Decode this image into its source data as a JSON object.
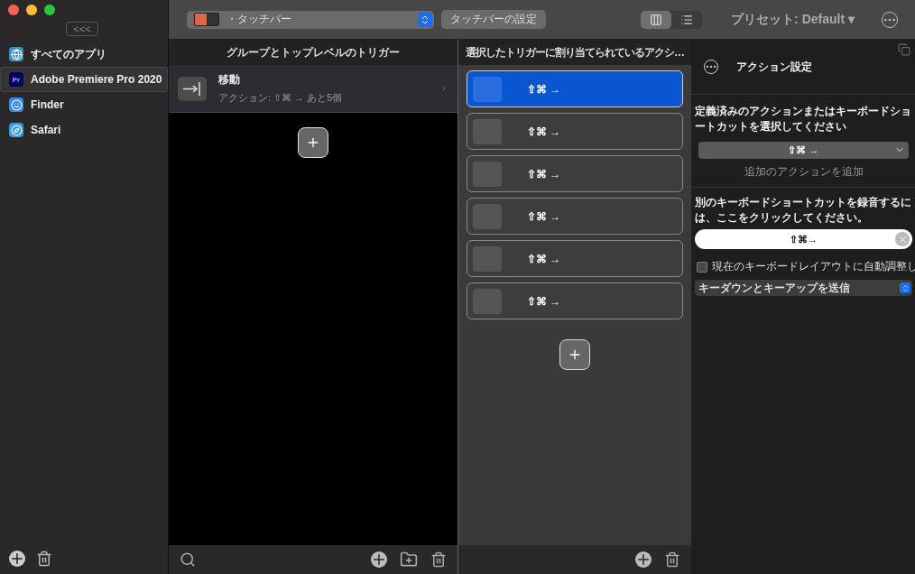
{
  "sidebar": {
    "collapse_button": "<<<",
    "apps": [
      {
        "name": "すべてのアプリ",
        "kind": "all",
        "selected": false
      },
      {
        "name": "Adobe Premiere Pro 2020",
        "kind": "premiere",
        "badge": "Pr",
        "selected": true
      },
      {
        "name": "Finder",
        "kind": "finder",
        "selected": false
      },
      {
        "name": "Safari",
        "kind": "safari",
        "selected": false
      }
    ]
  },
  "toolbar": {
    "touchbar_select": "・タッチバー",
    "settings_button": "タッチバーの設定",
    "view_toggle": [
      {
        "kind": "columns",
        "selected": true
      },
      {
        "kind": "list",
        "selected": false
      }
    ],
    "preset": "プリセット: Default",
    "preset_caret": "▾"
  },
  "triggers": {
    "header": "グループとトップレベルのトリガー",
    "items": [
      {
        "title": "移動",
        "subtitle": "アクション: ⇧⌘ → あと5個",
        "selected": true
      }
    ]
  },
  "actions": {
    "header": "選択したトリガーに割り当てられているアクシ…",
    "items": [
      {
        "label": "⇧⌘ →",
        "selected": true
      },
      {
        "label": "⇧⌘ →",
        "selected": false
      },
      {
        "label": "⇧⌘ →",
        "selected": false
      },
      {
        "label": "⇧⌘ →",
        "selected": false
      },
      {
        "label": "⇧⌘ →",
        "selected": false
      },
      {
        "label": "⇧⌘ →",
        "selected": false
      }
    ]
  },
  "settings": {
    "title": "アクション設定",
    "prompt": "定義済みのアクションまたはキーボードショートカットを選択してください",
    "action_select": "⇧⌘ →",
    "add_action_link": "追加のアクションを追加",
    "record_prompt": "別のキーボードショートカットを録音するには、ここをクリックしてください。",
    "record_field": "⇧⌘→",
    "auto_adjust": {
      "label": "現在のキーボードレイアウトに自動調整し",
      "checked": false
    },
    "send_mode": "キーダウンとキーアップを送信"
  }
}
